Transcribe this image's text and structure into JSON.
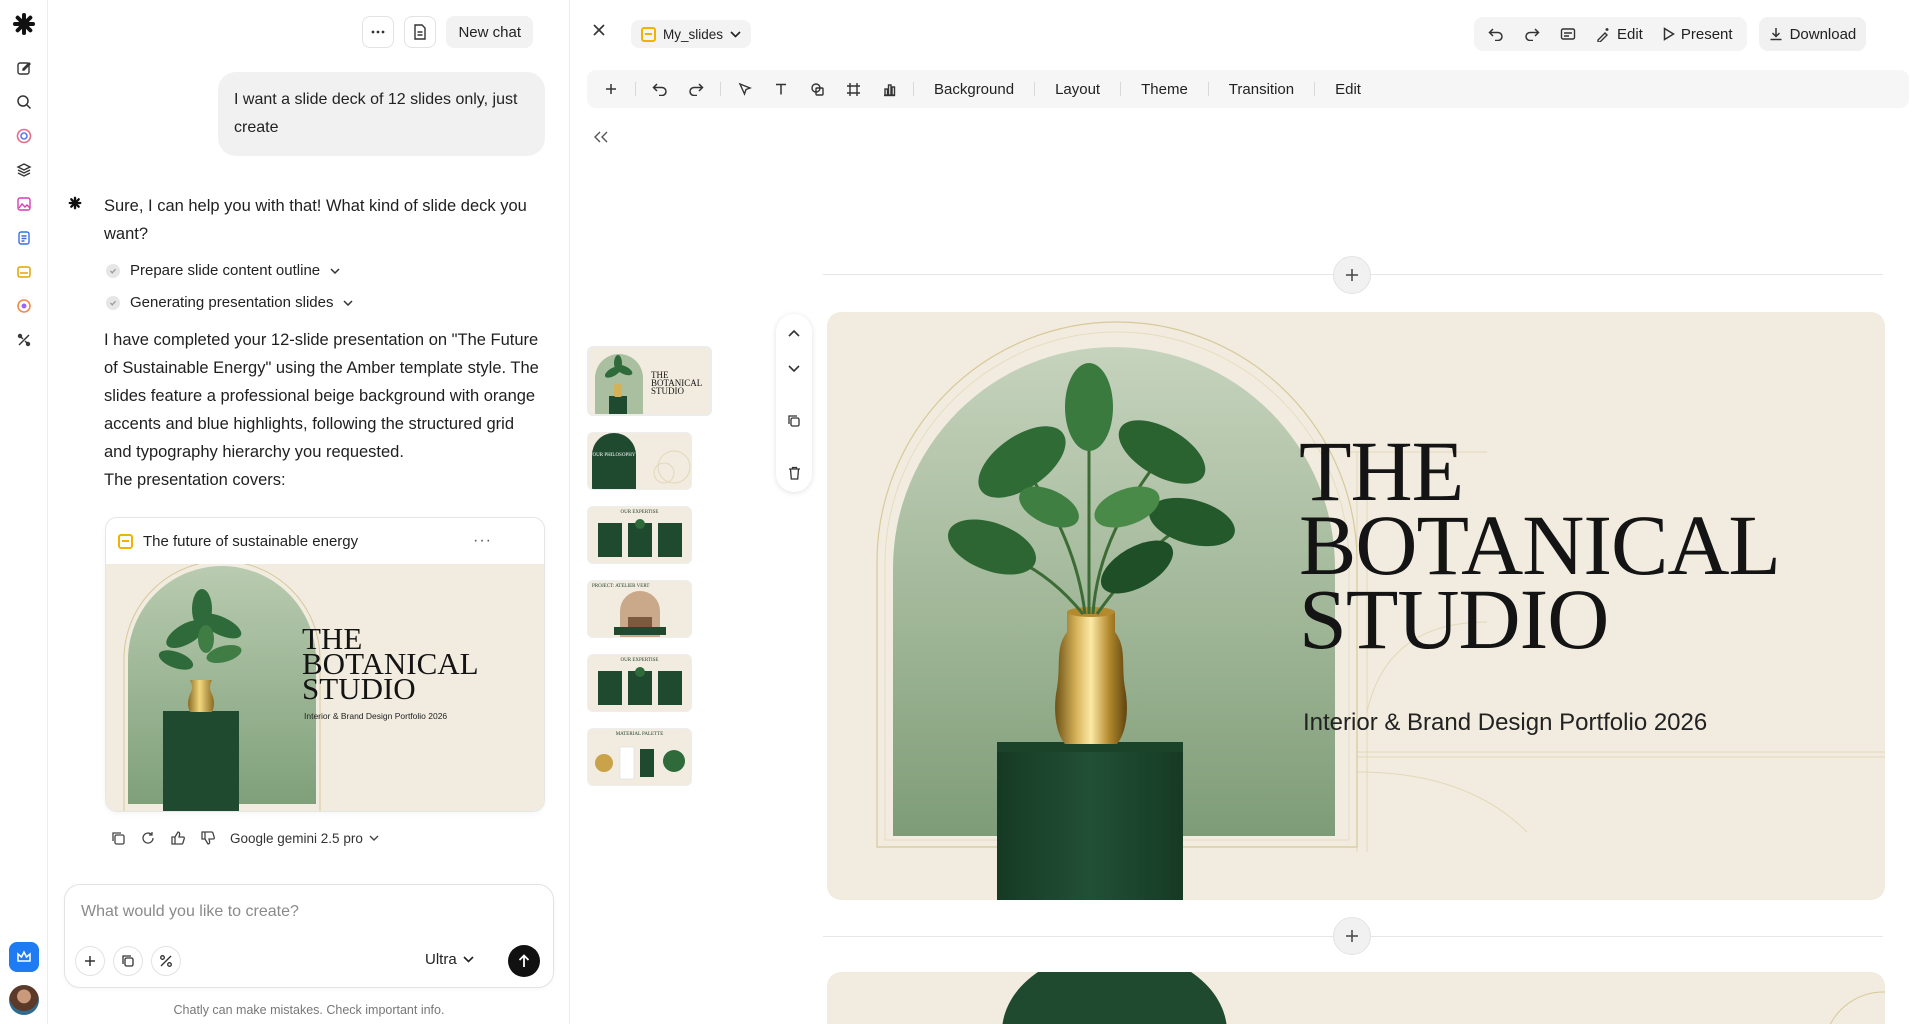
{
  "chat": {
    "new_chat_label": "New chat",
    "user_message": "I want a slide deck of 12 slides only, just create",
    "bot_intro": "Sure, I can help you with that! What kind of slide deck you want?",
    "steps": [
      {
        "label": "Prepare slide content outline"
      },
      {
        "label": "Generating presentation slides"
      }
    ],
    "bot_summary": "I have completed your 12-slide presentation on \"The Future of Sustainable Energy\" using the Amber template style. The slides feature a professional beige background with orange accents and blue highlights, following the structured grid and typography hierarchy you requested.",
    "covers_label": "The presentation covers:",
    "deck_card": {
      "title": "The future of sustainable energy",
      "more": "···"
    },
    "model_label": "Google gemini 2.5 pro",
    "composer": {
      "placeholder": "What would you like to create?",
      "mode": "Ultra"
    },
    "disclaimer": "Chatly can make mistakes. Check important info."
  },
  "editor": {
    "file_name": "My_slides",
    "buttons": {
      "edit": "Edit",
      "present": "Present",
      "download": "Download"
    },
    "toolbar": {
      "background": "Background",
      "layout": "Layout",
      "theme": "Theme",
      "transition": "Transition",
      "edit": "Edit"
    },
    "thumbnails": [
      {
        "label": "THE BOTANICAL STUDIO"
      },
      {
        "label": "OUR PHILOSOPHY"
      },
      {
        "label": "OUR EXPERTISE"
      },
      {
        "label": "PROJECT: ATELIER VERT"
      },
      {
        "label": "OUR EXPERTISE"
      },
      {
        "label": "MATERIAL PALETTE"
      }
    ],
    "slide": {
      "title_lines": [
        "THE",
        "BOTANICAL",
        "STUDIO"
      ],
      "subtitle": "Interior & Brand Design Portfolio 2026"
    }
  },
  "colors": {
    "slide_bg": "#f1ecdf",
    "forest_green": "#1f4a30",
    "gold": "#c9a24a",
    "accent_blue": "#1e7bf2",
    "file_icon": "#f0b400"
  }
}
